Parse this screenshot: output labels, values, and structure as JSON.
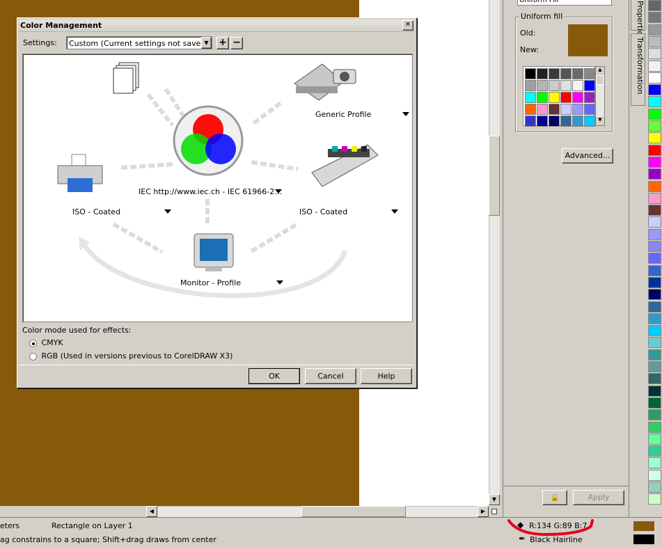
{
  "dialog": {
    "title": "Color Management",
    "close_glyph": "✕",
    "settings_label": "Settings:",
    "settings_value": "Custom (Current settings not saved)",
    "add_glyph": "+",
    "remove_glyph": "−",
    "workflow": {
      "generic_profile": "Generic Profile",
      "center_profile": "IEC http://www.iec.ch - IEC 61966-2...",
      "left_printer": "ISO - Coated",
      "right_press": "ISO - Coated",
      "monitor": "Monitor - Profile"
    },
    "color_mode_label": "Color mode used for effects:",
    "mode_cmyk": "CMYK",
    "mode_rgb": "RGB (Used in versions previous to CorelDRAW X3)",
    "selected_mode": "CMYK",
    "ok_label": "OK",
    "cancel_label": "Cancel",
    "help_label": "Help"
  },
  "docker": {
    "fill_type": "Uniform Fill",
    "group_title": "Uniform fill",
    "old_label": "Old:",
    "new_label": "New:",
    "old_color": "#875a0b",
    "new_color": "#875a0b",
    "swatches": [
      "#000000",
      "#222222",
      "#3a3a3a",
      "#555555",
      "#6a6a6a",
      "#888888",
      "#a0a0a0",
      "#b4b4b4",
      "#cacaca",
      "#e0e0e0",
      "#f4f4f4",
      "#0000ff",
      "#00ffff",
      "#00ff00",
      "#ffff00",
      "#ff0000",
      "#ff00ff",
      "#9c1fc0",
      "#ff6600",
      "#ff99cc",
      "#663333",
      "#ccccff",
      "#9999ff",
      "#6666ff",
      "#3333cc",
      "#000099",
      "#000066",
      "#336699",
      "#3399cc",
      "#00ccff"
    ],
    "advanced_label": "Advanced...",
    "lock_glyph": "🔒",
    "apply_label": "Apply",
    "tab_properties": "Properties",
    "tab_transformation": "Transformation"
  },
  "palette": [
    "#666666",
    "#777777",
    "#999999",
    "#bbbbbb",
    "#dddddd",
    "#f0f0f0",
    "#ffffff",
    "#0000ff",
    "#00ffff",
    "#00ff00",
    "#66ff33",
    "#ffff00",
    "#ff0000",
    "#ff00ff",
    "#9900cc",
    "#ff6600",
    "#ff99cc",
    "#663333",
    "#ccccff",
    "#9999ff",
    "#8888ee",
    "#6666ff",
    "#3366cc",
    "#003399",
    "#000066",
    "#336699",
    "#3399cc",
    "#00ccff",
    "#66cccc",
    "#339999",
    "#669999",
    "#336666",
    "#003333",
    "#006633",
    "#339966",
    "#33cc66",
    "#66ff99",
    "#33cc99",
    "#99ffcc",
    "#ccffee",
    "#99ccbb",
    "#ccffcc"
  ],
  "statusbar": {
    "left_text": "eters",
    "object_info": "Rectangle on Layer 1",
    "hint": "ag constrains to a square; Shift+drag draws from center",
    "fill_values": "R:134 G:89 B:7",
    "outline_label": "Black  Hairline",
    "fill_color": "#875a0b",
    "outline_color": "#000000",
    "highlight_color": "#e8001c"
  }
}
